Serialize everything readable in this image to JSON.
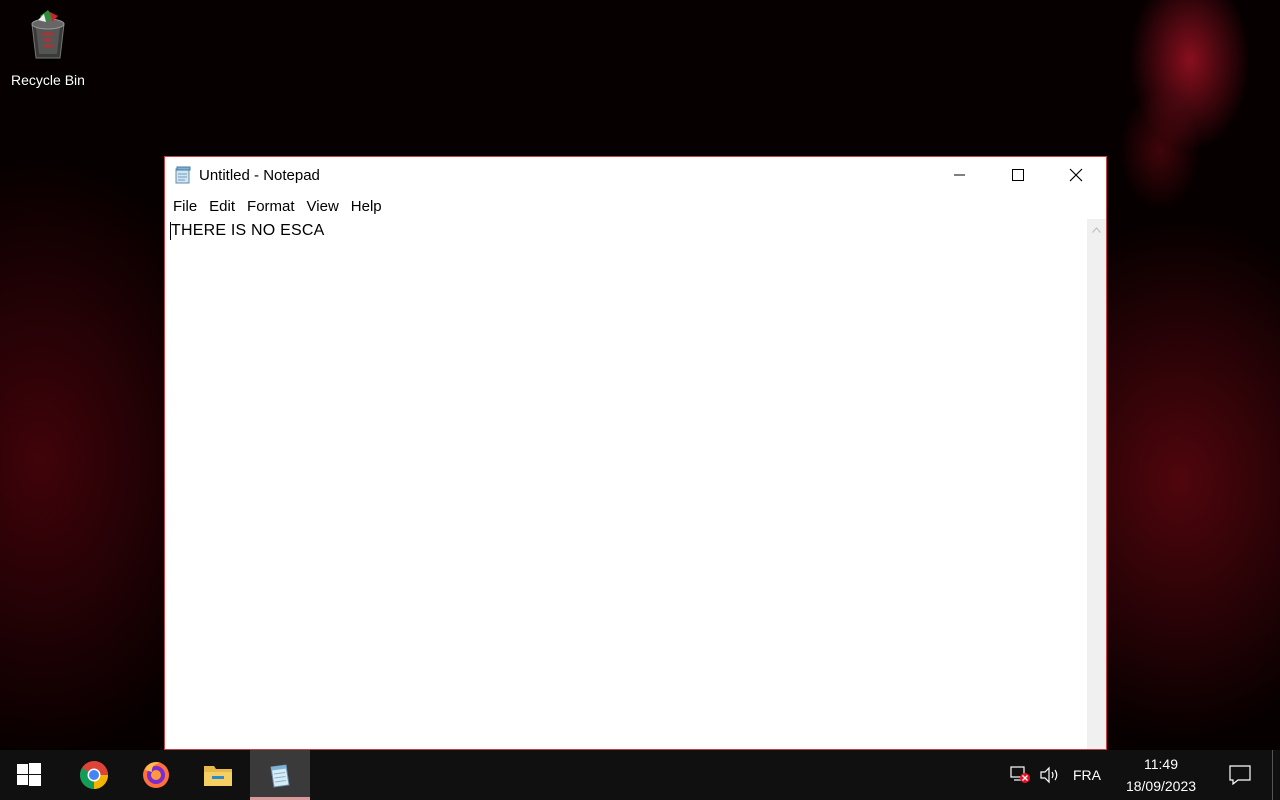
{
  "desktop": {
    "icons": [
      {
        "label": "Recycle Bin",
        "icon": "recycle-bin-icon"
      }
    ]
  },
  "notepad": {
    "title": "Untitled - Notepad",
    "menu": [
      "File",
      "Edit",
      "Format",
      "View",
      "Help"
    ],
    "content": "THERE IS NO ESCA"
  },
  "taskbar": {
    "apps": [
      {
        "name": "start",
        "icon": "windows-start-icon",
        "active": false
      },
      {
        "name": "chrome",
        "icon": "chrome-icon",
        "active": false
      },
      {
        "name": "firefox",
        "icon": "firefox-icon",
        "active": false
      },
      {
        "name": "file-explorer",
        "icon": "folder-icon",
        "active": false
      },
      {
        "name": "notepad",
        "icon": "notepad-icon",
        "active": true
      }
    ],
    "tray": {
      "language": "FRA",
      "time": "11:49",
      "date": "18/09/2023"
    }
  },
  "colors": {
    "desktop_bg": "#070000",
    "taskbar_bg": "#101010",
    "window_border": "#c94040",
    "active_indicator": "#d89a9a"
  }
}
